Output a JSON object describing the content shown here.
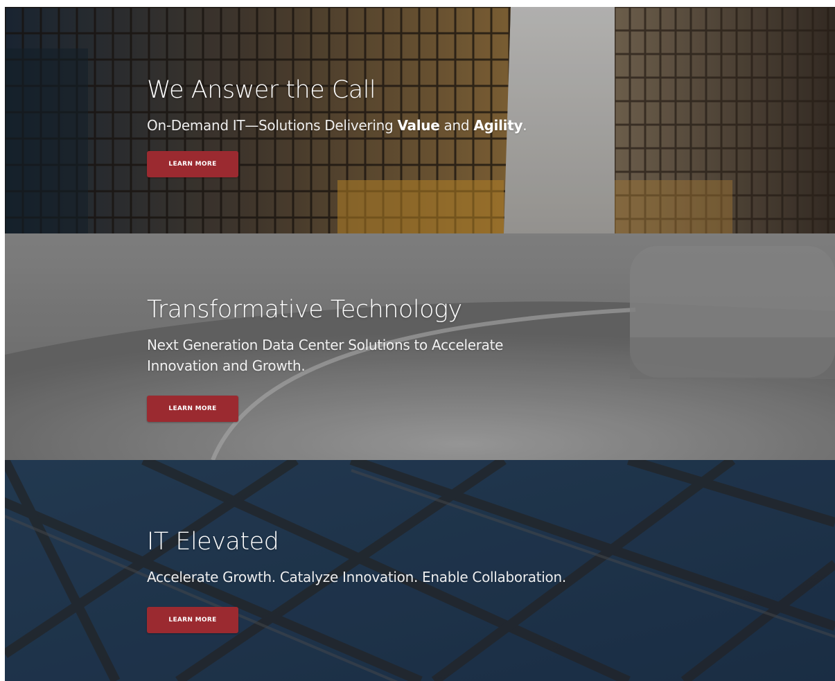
{
  "panels": [
    {
      "title": "We Answer the Call",
      "subtitle_parts": [
        "On-Demand IT—Solutions Delivering ",
        "Value",
        " and ",
        "Agility",
        "."
      ],
      "button_label": "LEARN MORE",
      "background": "glass-office-towers-photo"
    },
    {
      "title": "Transformative Technology",
      "subtitle": "Next Generation Data Center Solutions to Accelerate Innovation and Growth.",
      "button_label": "LEARN MORE",
      "background": "concrete-curved-architecture-photo"
    },
    {
      "title": "IT Elevated",
      "subtitle": "Accelerate Growth. Catalyze Innovation. Enable Collaboration.",
      "button_label": "LEARN MORE",
      "background": "glass-dome-ceiling-photo"
    }
  ],
  "colors": {
    "button": "#9b2a30",
    "text": "#ffffff",
    "panel1_tone": "#5a4a3a",
    "panel2_tone": "#7a7a7a",
    "panel3_tone": "#2f4a66"
  }
}
